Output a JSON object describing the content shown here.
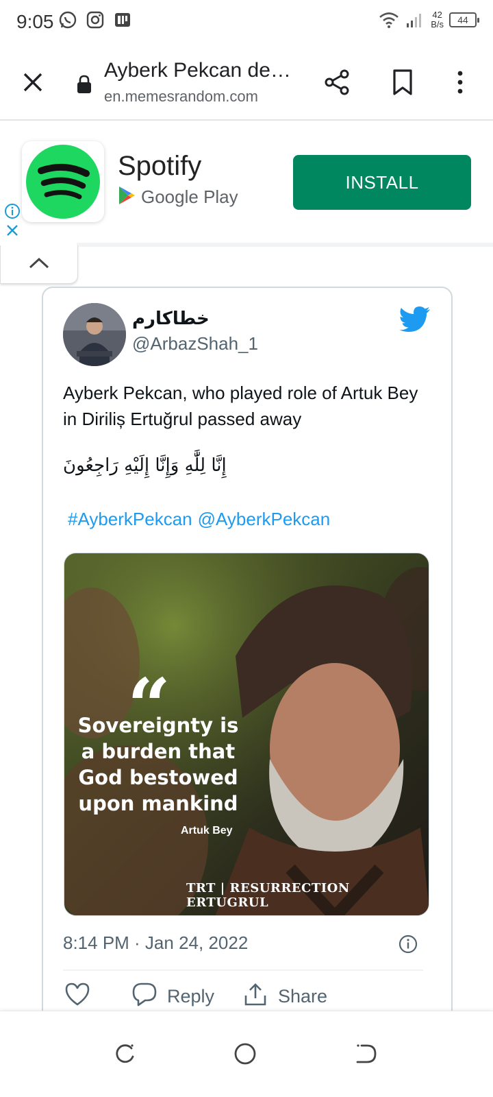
{
  "status_bar": {
    "time": "9:05",
    "net_speed_value": "42",
    "net_speed_unit": "B/s",
    "battery": "44",
    "icons": [
      "whatsapp-icon",
      "instagram-icon",
      "news-icon",
      "wifi-icon",
      "signal-icon"
    ]
  },
  "toolbar": {
    "title": "Ayberk Pekcan de…",
    "url": "en.memesrandom.com",
    "icons": [
      "close-icon",
      "lock-icon",
      "share-icon",
      "bookmark-icon",
      "more-vert-icon"
    ]
  },
  "ad": {
    "app_name": "Spotify",
    "store": "Google Play",
    "install_label": "INSTALL",
    "install_color": "#01875f",
    "brand_color": "#1ed760"
  },
  "tweet": {
    "display_name": "خطاکارم",
    "handle": "@ArbazShah_1",
    "text": "Ayberk Pekcan, who played role of Artuk Bey in Diriliș Ertuğrul passed away",
    "arabic": "إِنَّا لِلَّٰهِ وَإِنَّا إِلَيْهِ رَاجِعُونَ",
    "hashtag": "#AyberkPekcan",
    "mention": "@AyberkPekcan",
    "media": {
      "quote": "Sovereignty is a burden that God bestowed upon mankind",
      "author": "Artuk Bey",
      "logo": "TRT | RESURRECTION ERTUGRUL"
    },
    "timestamp": "8:14 PM · Jan 24, 2022",
    "actions": {
      "reply_label": "Reply",
      "share_label": "Share"
    },
    "accent_color": "#1d9bf0"
  },
  "navbar": {
    "buttons": [
      "recent-apps-button",
      "home-button",
      "back-button"
    ]
  }
}
